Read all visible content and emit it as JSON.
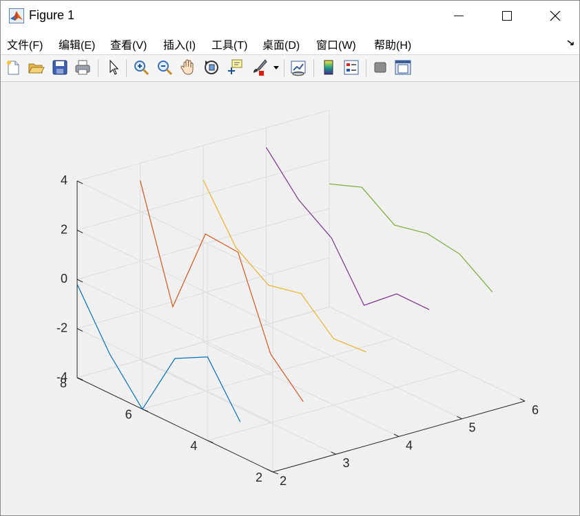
{
  "window": {
    "title": "Figure 1"
  },
  "menu": [
    {
      "label": "文件(F)"
    },
    {
      "label": "编辑(E)"
    },
    {
      "label": "查看(V)"
    },
    {
      "label": "插入(I)"
    },
    {
      "label": "工具(T)"
    },
    {
      "label": "桌面(D)"
    },
    {
      "label": "窗口(W)"
    },
    {
      "label": "帮助(H)"
    }
  ],
  "toolbar": [
    "new-figure-icon",
    "open-file-icon",
    "save-icon",
    "print-icon",
    "pointer-icon",
    "zoom-in-icon",
    "zoom-out-icon",
    "pan-hand-icon",
    "rotate-3d-icon",
    "data-cursor-icon",
    "brush-icon",
    "link-plot-icon",
    "colorbar-icon",
    "legend-icon",
    "hide-plot-tools-icon",
    "show-plot-tools-icon"
  ],
  "colors": {
    "series": [
      "#0072BD",
      "#D95319",
      "#EDB120",
      "#7E2F8E",
      "#77AC30"
    ],
    "axis": "#262626",
    "grid": "#dcdcdc"
  },
  "chart_data": {
    "type": "line",
    "title": "",
    "xlabel": "",
    "ylabel": "",
    "zlabel": "",
    "xlim": [
      2,
      6
    ],
    "ylim": [
      2,
      8
    ],
    "zlim": [
      -4,
      4
    ],
    "xticks": [
      2,
      3,
      4,
      5,
      6
    ],
    "yticks": [
      2,
      4,
      6,
      8
    ],
    "zticks": [
      -4,
      -2,
      0,
      2,
      4
    ],
    "grid": true,
    "legend": "none",
    "series": [
      {
        "x": [
          2,
          2,
          2,
          2,
          2,
          2
        ],
        "y": [
          3,
          4,
          5,
          6,
          7,
          8
        ],
        "z": [
          -2.6,
          -0.6,
          -1.3,
          -4.0,
          -2.4,
          -0.2
        ]
      },
      {
        "x": [
          3,
          3,
          3,
          3,
          3,
          3
        ],
        "y": [
          3,
          4,
          5,
          6,
          7,
          8
        ],
        "z": [
          -2.5,
          -1.2,
          2.3,
          2.4,
          -1.2,
          3.3
        ]
      },
      {
        "x": [
          4,
          4,
          4,
          4,
          4,
          4
        ],
        "y": [
          3,
          4,
          5,
          6,
          7,
          8
        ],
        "z": [
          -1.2,
          -1.3,
          -0.1,
          -0.4,
          0.5,
          2.6
        ]
      },
      {
        "x": [
          5,
          5,
          5,
          5,
          5,
          5
        ],
        "y": [
          3,
          4,
          5,
          6,
          7,
          8
        ],
        "z": [
          -0.2,
          -0.2,
          -1.3,
          0.8,
          1.7,
          3.2
        ]
      },
      {
        "x": [
          6,
          6,
          6,
          6,
          6,
          6
        ],
        "y": [
          3,
          4,
          5,
          6,
          7,
          8
        ],
        "z": [
          -0.2,
          0.7,
          0.9,
          0.6,
          1.5,
          1.0
        ]
      }
    ]
  }
}
